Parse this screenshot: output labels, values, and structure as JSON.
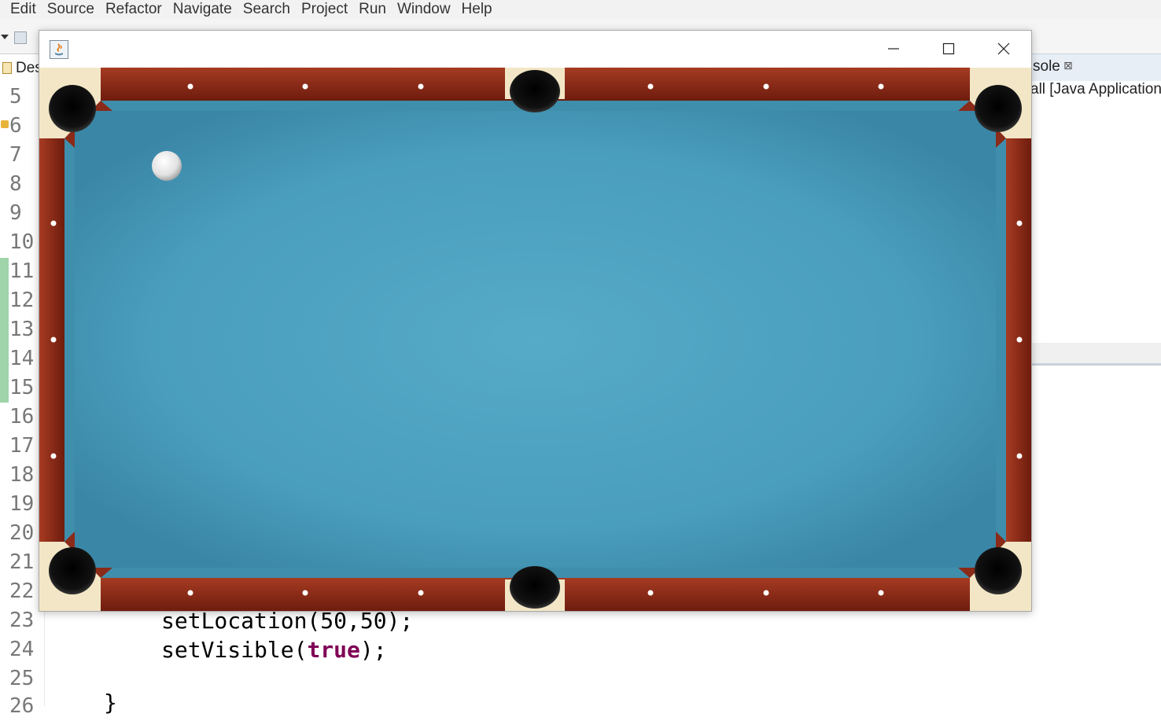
{
  "menubar": {
    "items": [
      "Edit",
      "Source",
      "Refactor",
      "Navigate",
      "Search",
      "Project",
      "Run",
      "Window",
      "Help"
    ]
  },
  "editor_tab": {
    "label": "Des"
  },
  "console": {
    "tab_label": "sole",
    "description": "all [Java Application"
  },
  "editor": {
    "line_numbers": [
      "5",
      "6",
      "7",
      "8",
      "9",
      "10",
      "11",
      "12",
      "13",
      "14",
      "15",
      "16",
      "17",
      "18",
      "19",
      "20",
      "21",
      "22",
      "23",
      "24",
      "25",
      "26"
    ],
    "code": {
      "line23": "setLocation(50,50);",
      "line24_pre": "setVisible(",
      "line24_kw": "true",
      "line24_post": ");",
      "line26": "}"
    }
  },
  "java_window": {
    "icon": "java-coffee-icon",
    "controls": [
      "minimize-icon",
      "maximize-icon",
      "close-icon"
    ]
  },
  "colors": {
    "felt": "#4aa3c3",
    "rail_wood": "#8a2a18",
    "keyword": "#7f0055",
    "ball": "#e9e9e9"
  }
}
